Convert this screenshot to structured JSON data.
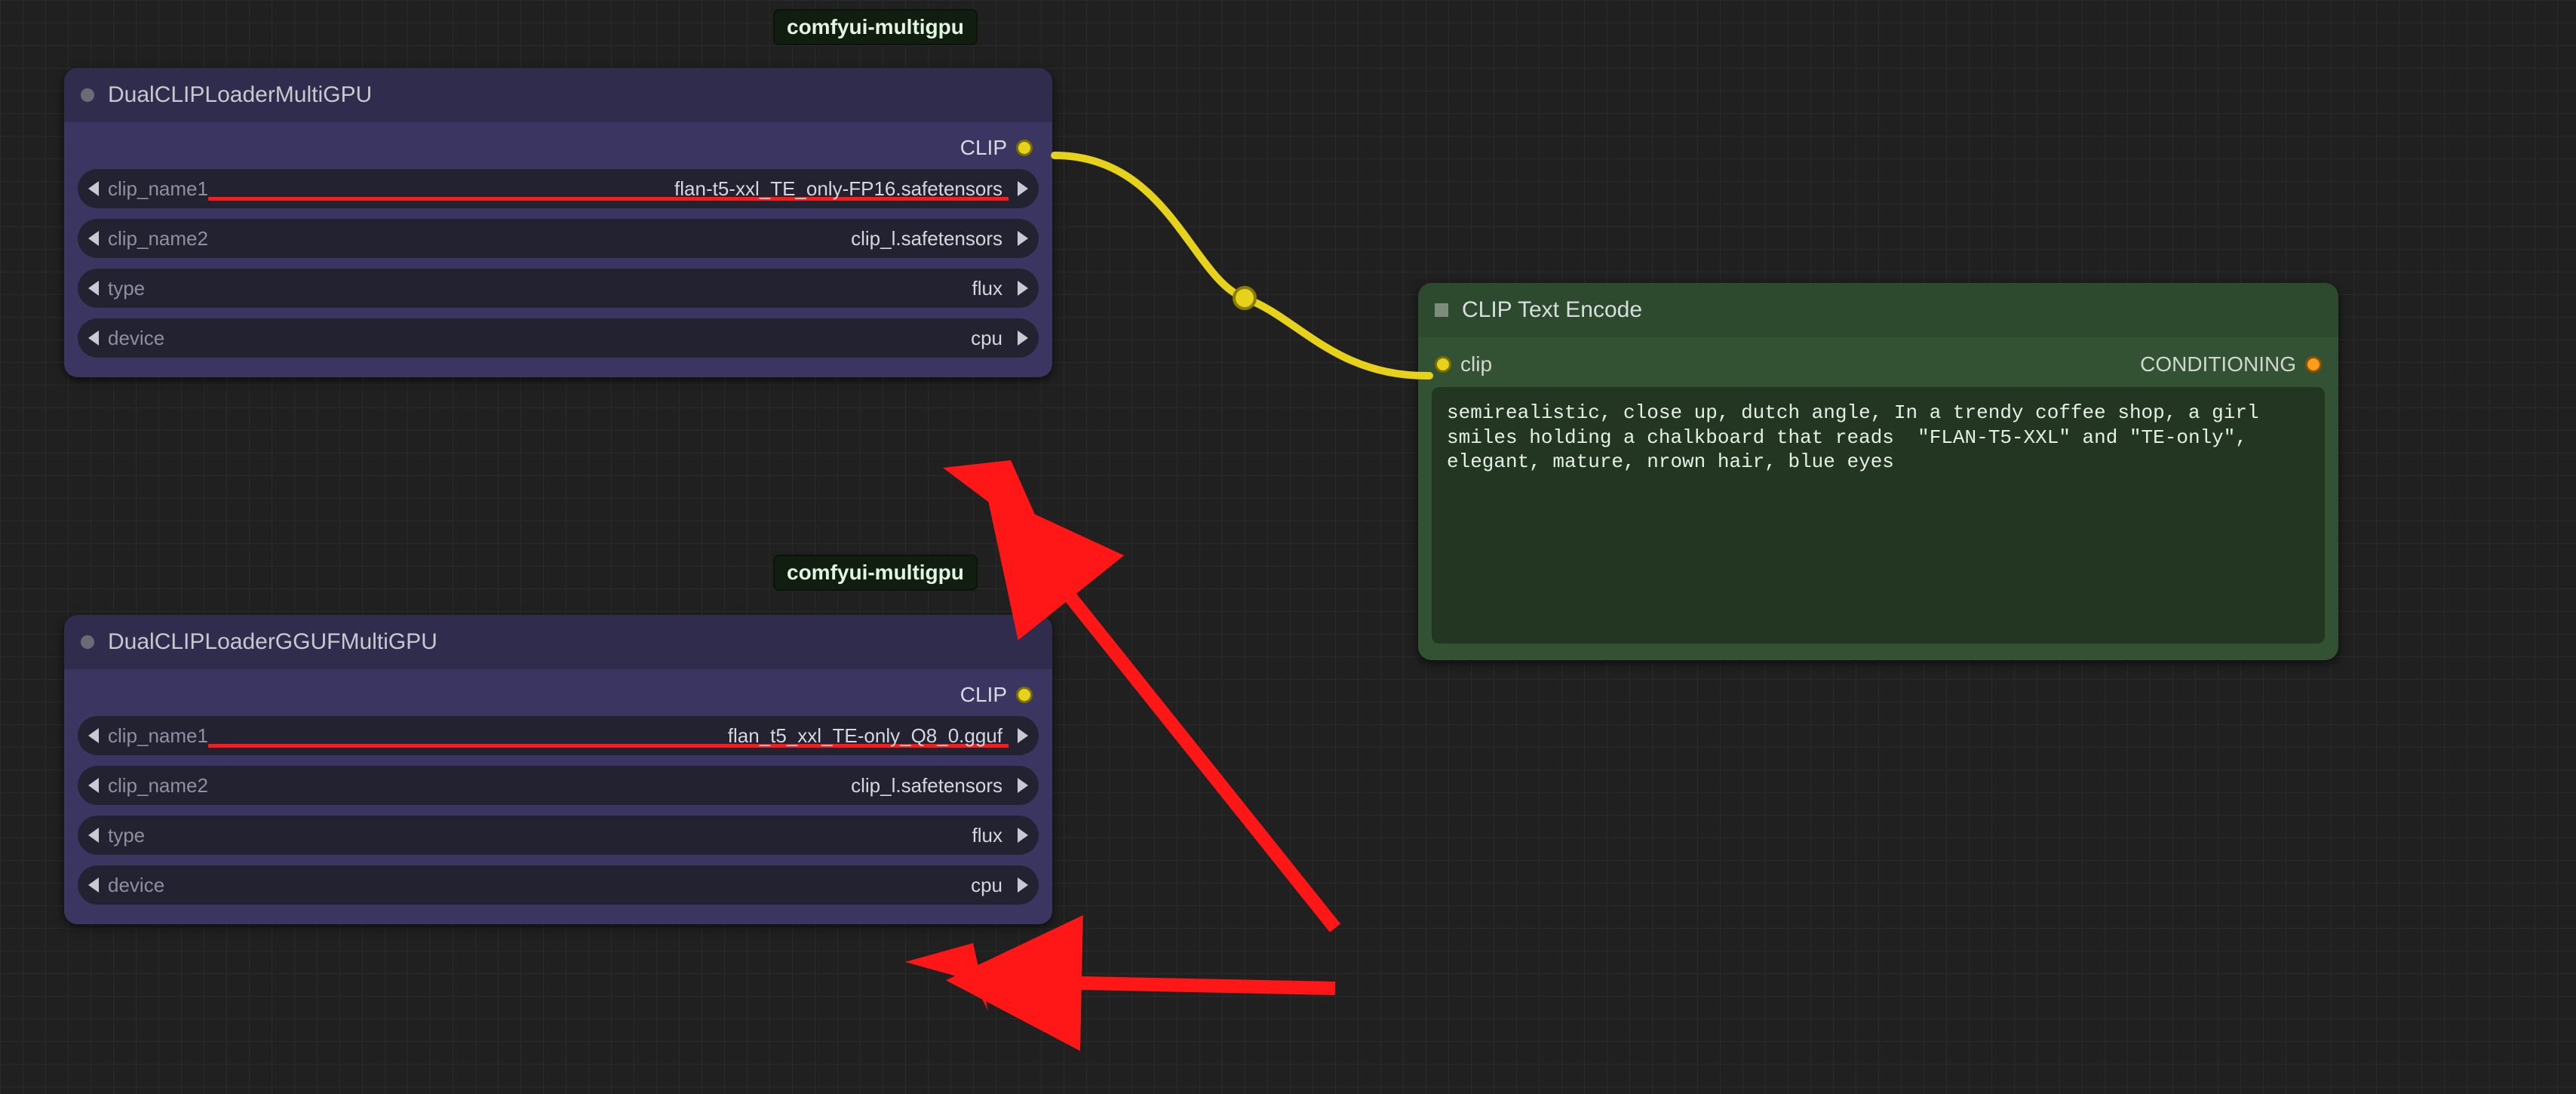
{
  "badges": {
    "top": "comfyui-multigpu",
    "mid": "comfyui-multigpu"
  },
  "node1": {
    "title": "DualCLIPLoaderMultiGPU",
    "output": "CLIP",
    "fields": {
      "clip_name1": {
        "label": "clip_name1",
        "value": "flan-t5-xxl_TE_only-FP16.safetensors"
      },
      "clip_name2": {
        "label": "clip_name2",
        "value": "clip_l.safetensors"
      },
      "type": {
        "label": "type",
        "value": "flux"
      },
      "device": {
        "label": "device",
        "value": "cpu"
      }
    }
  },
  "node2": {
    "title": "DualCLIPLoaderGGUFMultiGPU",
    "output": "CLIP",
    "fields": {
      "clip_name1": {
        "label": "clip_name1",
        "value": "flan_t5_xxl_TE-only_Q8_0.gguf"
      },
      "clip_name2": {
        "label": "clip_name2",
        "value": "clip_l.safetensors"
      },
      "type": {
        "label": "type",
        "value": "flux"
      },
      "device": {
        "label": "device",
        "value": "cpu"
      }
    }
  },
  "encode": {
    "title": "CLIP Text Encode",
    "input": "clip",
    "output": "CONDITIONING",
    "prompt": "semirealistic, close up, dutch angle, In a trendy coffee shop, a girl smiles holding a chalkboard that reads  \"FLAN-T5-XXL\" and \"TE-only\", elegant, mature, nrown hair, blue eyes"
  },
  "colors": {
    "wire": "#e6d21a",
    "annotation": "#ff1717"
  }
}
